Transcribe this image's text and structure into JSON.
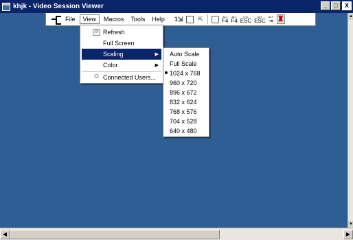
{
  "window": {
    "title": "khjk - Video Session Viewer",
    "minimize": "_",
    "maximize": "□",
    "close": "X"
  },
  "toolbar": {
    "menus": [
      "File",
      "View",
      "Macros",
      "Tools",
      "Help"
    ],
    "active_menu": "View",
    "icons": [
      "pin-icon",
      "single-cursor-icon",
      "frame-icon",
      "pointer-icon",
      "screen-icon"
    ],
    "keys": [
      {
        "top": "ALT",
        "bottom": "F4"
      },
      {
        "top": "ALT",
        "bottom": "F4"
      },
      {
        "top": "CTL",
        "bottom": "ESC"
      },
      {
        "top": "ALT",
        "bottom": "ESC"
      },
      {
        "top": "ALT",
        "bottom": "⇥"
      }
    ]
  },
  "view_menu": {
    "items": [
      {
        "label": "Refresh",
        "underline": "R"
      },
      {
        "label": "Full Screen",
        "underline": "F"
      },
      {
        "label": "Scaling",
        "underline": "S",
        "submenu": true,
        "highlighted": true
      },
      {
        "label": "Color",
        "underline": "C",
        "submenu": true
      },
      {
        "label": "Connected Users...",
        "underline": "U"
      }
    ]
  },
  "scaling_menu": {
    "items": [
      "Auto Scale",
      "Full Scale",
      "1024 x 768",
      "960 x 720",
      "896 x 672",
      "832 x 624",
      "768 x 576",
      "704 x 528",
      "640 x 480"
    ],
    "selected": "1024 x 768"
  },
  "colors": {
    "titlebar": "#0a246a",
    "session_background": "#2e5e94",
    "highlight": "#0a246a"
  }
}
